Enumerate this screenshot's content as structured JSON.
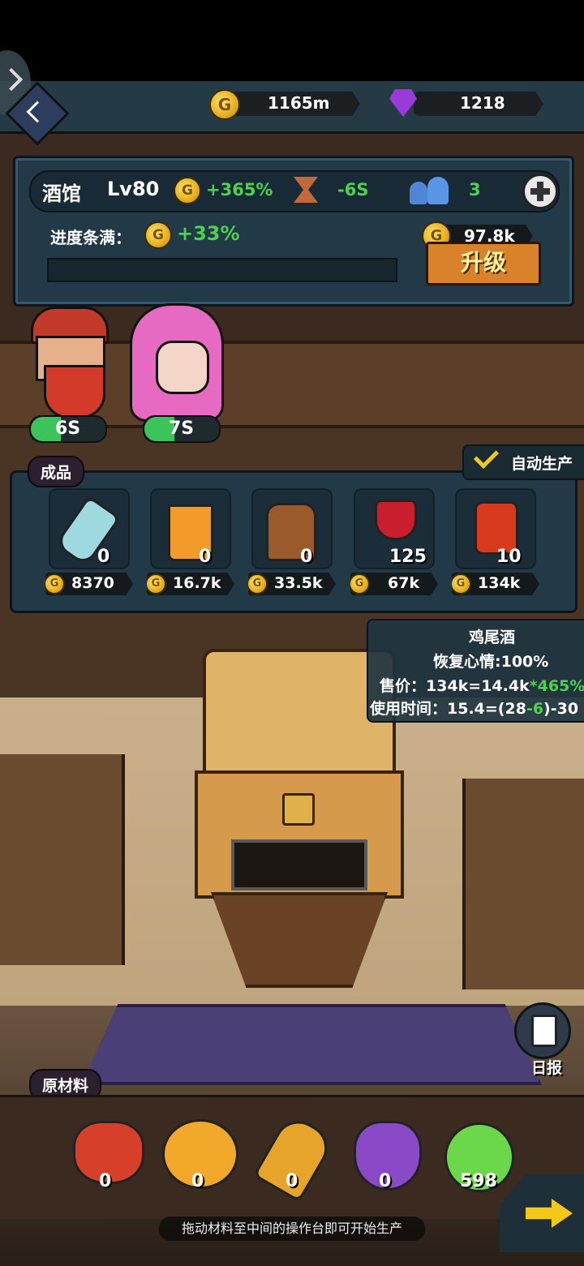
{
  "header": {
    "gold": "1165m",
    "gems": "1218"
  },
  "tavern": {
    "name": "酒馆",
    "level": "Lv80",
    "income_bonus": "+365%",
    "time_bonus": "-6S",
    "staff_count": "3",
    "progress_label": "进度条满：",
    "progress_bonus": "+33%",
    "progress_fraction": 0.0,
    "upgrade_cost": "97.8k",
    "upgrade_label": "升级"
  },
  "workers": [
    {
      "timer": "6S",
      "fill": 0.4
    },
    {
      "timer": "7S",
      "fill": 0.4
    }
  ],
  "products": {
    "tab_label": "成品",
    "auto_label": "自动生产",
    "items": [
      {
        "icon": "water-bottle-icon",
        "count": "0",
        "price": "8370"
      },
      {
        "icon": "juice-glass-icon",
        "count": "0",
        "price": "16.7k"
      },
      {
        "icon": "beer-mug-icon",
        "count": "0",
        "price": "33.5k"
      },
      {
        "icon": "wine-glass-icon",
        "count": "125",
        "price": "67k"
      },
      {
        "icon": "cocktail-icon",
        "count": "10",
        "price": "134k"
      }
    ]
  },
  "tooltip": {
    "title": "鸡尾酒",
    "line1": "恢复心情:100%",
    "line2a": "售价：134k=14.4k",
    "line2b": "*465%",
    "line3a": "使用时间：15.4=(28",
    "line3b": "-6",
    "line3c": ")-30"
  },
  "daily_report_label": "日报",
  "materials": {
    "tab_label": "原材料",
    "items": [
      {
        "icon": "apple-icon",
        "count": "0"
      },
      {
        "icon": "orange-icon",
        "count": "0"
      },
      {
        "icon": "wheat-icon",
        "count": "0"
      },
      {
        "icon": "grapes-icon",
        "count": "0"
      },
      {
        "icon": "potion-icon",
        "count": "598"
      }
    ]
  },
  "hint": "拖动材料至中间的操作台即可开始生产"
}
